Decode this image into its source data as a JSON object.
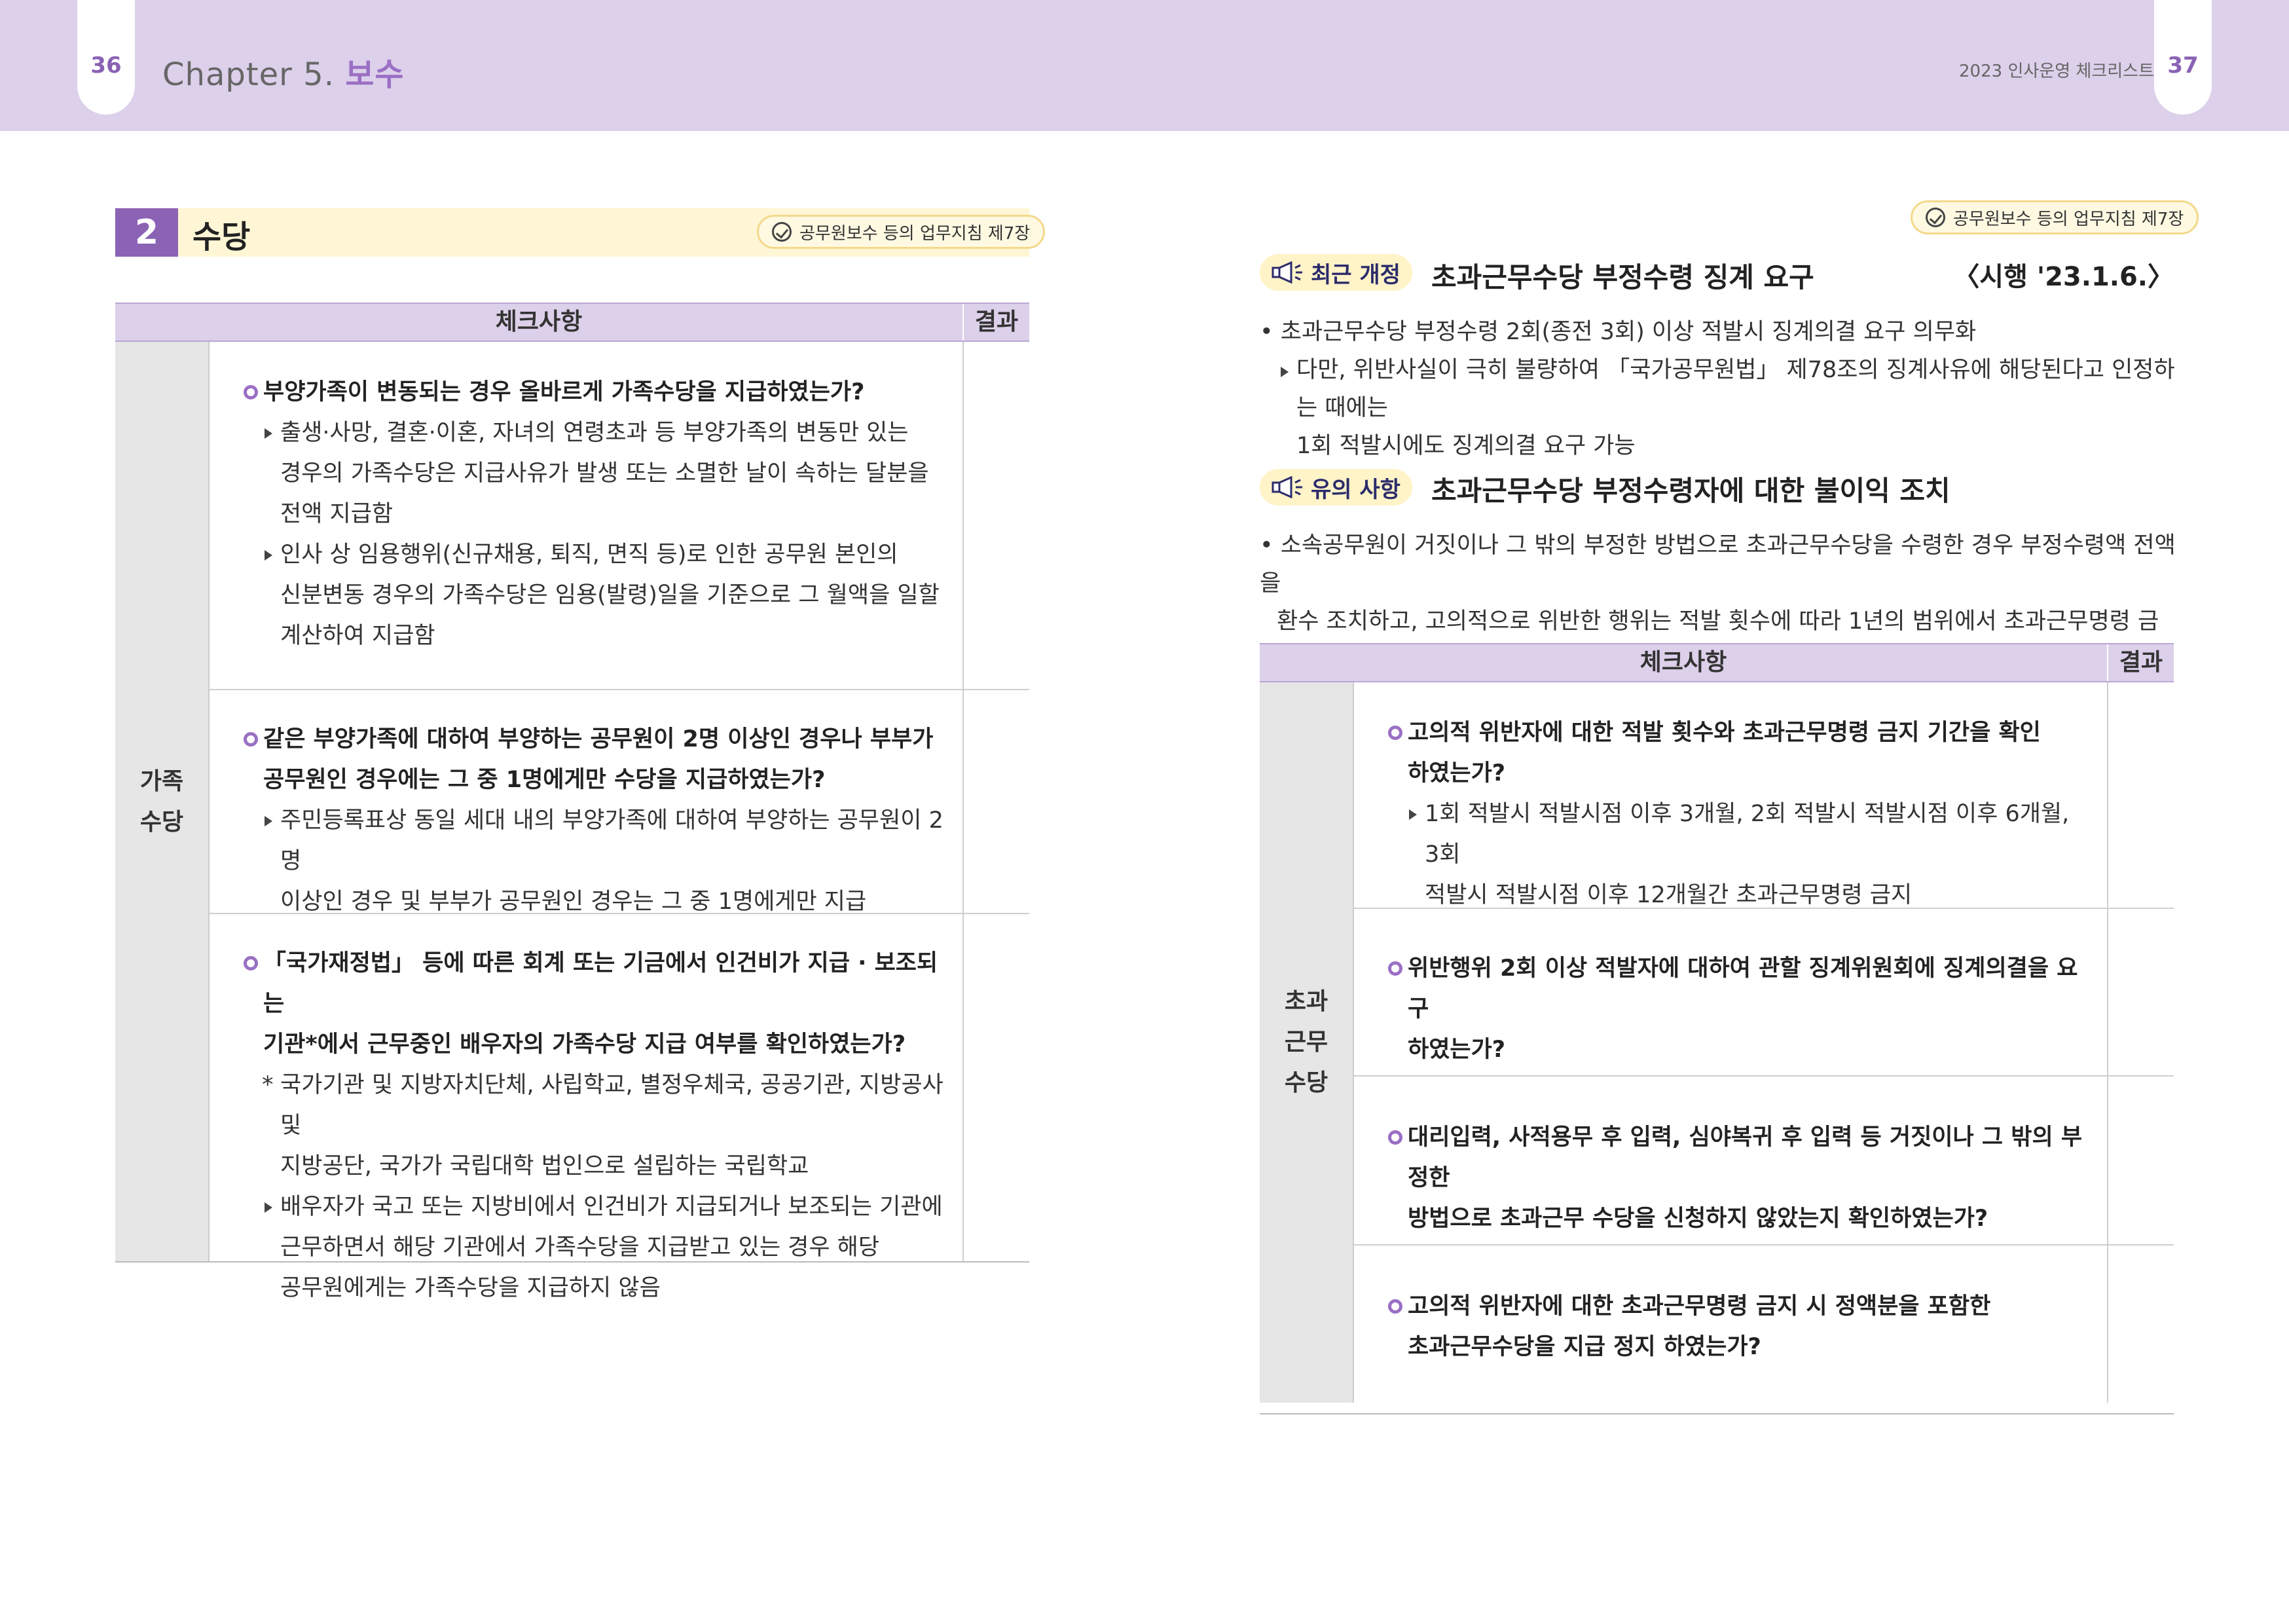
{
  "header": {
    "left_page_number": "36",
    "chapter_prefix": "Chapter 5.",
    "chapter_title": "보수",
    "running_title": "2023 인사운영 체크리스트",
    "right_page_number": "37"
  },
  "left": {
    "section_number": "2",
    "section_title": "수당",
    "reference": "공무원보수 등의 업무지침 제7장",
    "table": {
      "col_check": "체크사항",
      "col_result": "결과",
      "category": "가족\n수당",
      "rows": [
        {
          "question": "부양가족이 변동되는 경우 올바르게 가족수당을 지급하였는가?",
          "subs": [
            [
              "출생·사망, 결혼·이혼, 자녀의 연령초과 등 부양가족의 변동만 있는",
              "경우의 가족수당은 지급사유가 발생 또는 소멸한 날이 속하는 달분을",
              "전액 지급함"
            ],
            [
              "인사 상 임용행위(신규채용, 퇴직, 면직 등)로 인한 공무원 본인의",
              "신분변동 경우의 가족수당은 임용(발령)일을 기준으로 그 월액을 일할",
              "계산하여 지급함"
            ]
          ]
        },
        {
          "question_lines": [
            "같은 부양가족에 대하여 부양하는 공무원이 2명 이상인 경우나 부부가",
            "공무원인 경우에는 그 중 1명에게만 수당을 지급하였는가?"
          ],
          "subs": [
            [
              "주민등록표상 동일 세대 내의 부양가족에 대하여 부양하는 공무원이 2명",
              "이상인 경우 및 부부가 공무원인 경우는 그 중 1명에게만 지급"
            ]
          ]
        },
        {
          "question_lines": [
            "「국가재정법」 등에 따른 회계 또는 기금에서 인건비가 지급 · 보조되는",
            "기관*에서 근무중인 배우자의 가족수당 지급 여부를 확인하였는가?"
          ],
          "note": [
            "국가기관 및 지방자치단체, 사립학교, 별정우체국, 공공기관, 지방공사 및",
            "지방공단, 국가가 국립대학 법인으로 설립하는 국립학교"
          ],
          "subs": [
            [
              "배우자가 국고 또는 지방비에서 인건비가 지급되거나 보조되는 기관에",
              "근무하면서 해당 기관에서 가족수당을 지급받고 있는 경우 해당",
              "공무원에게는 가족수당을 지급하지 않음"
            ]
          ]
        }
      ]
    }
  },
  "right": {
    "reference": "공무원보수 등의 업무지침 제7장",
    "notice1": {
      "badge": "최근 개정",
      "title": "초과근무수당 부정수령 징계 요구",
      "date": "〈시행 '23.1.6.〉",
      "bullet": "• 초과근무수당 부정수령 2회(종전 3회) 이상 적발시 징계의결 요구 의무화",
      "sub_lines": [
        "다만, 위반사실이 극히 불량하여 「국가공무원법」 제78조의 징계사유에 해당된다고 인정하는 때에는",
        "1회 적발시에도 징계의결 요구 가능"
      ]
    },
    "notice2": {
      "badge": "유의 사항",
      "title": "초과근무수당 부정수령자에 대한 불이익 조치",
      "bullet_lines": [
        "• 소속공무원이 거짓이나 그 밖의 부정한 방법으로 초과근무수당을 수령한 경우 부정수령액 전액을",
        "환수 조치하고, 고의적으로 위반한 행위는 적발 횟수에 따라 1년의 범위에서 초과근무명령 금지"
      ]
    },
    "table": {
      "col_check": "체크사항",
      "col_result": "결과",
      "category": "초과\n근무\n수당",
      "rows": [
        {
          "question_lines": [
            "고의적 위반자에 대한 적발 횟수와 초과근무명령 금지 기간을 확인",
            "하였는가?"
          ],
          "sub_lines": [
            "1회 적발시 적발시점 이후 3개월, 2회 적발시 적발시점 이후 6개월, 3회",
            "적발시 적발시점 이후 12개월간 초과근무명령 금지"
          ]
        },
        {
          "question_lines": [
            "위반행위 2회 이상 적발자에 대하여 관할 징계위원회에 징계의결을 요구",
            "하였는가?"
          ]
        },
        {
          "question_lines": [
            "대리입력, 사적용무 후 입력, 심야복귀 후 입력 등 거짓이나 그 밖의 부정한",
            "방법으로 초과근무 수당을 신청하지 않았는지 확인하였는가?"
          ]
        },
        {
          "question_lines": [
            "고의적 위반자에 대한 초과근무명령 금지 시 정액분을 포함한",
            "초과근무수당을 지급 정지 하였는가?"
          ]
        }
      ]
    }
  }
}
